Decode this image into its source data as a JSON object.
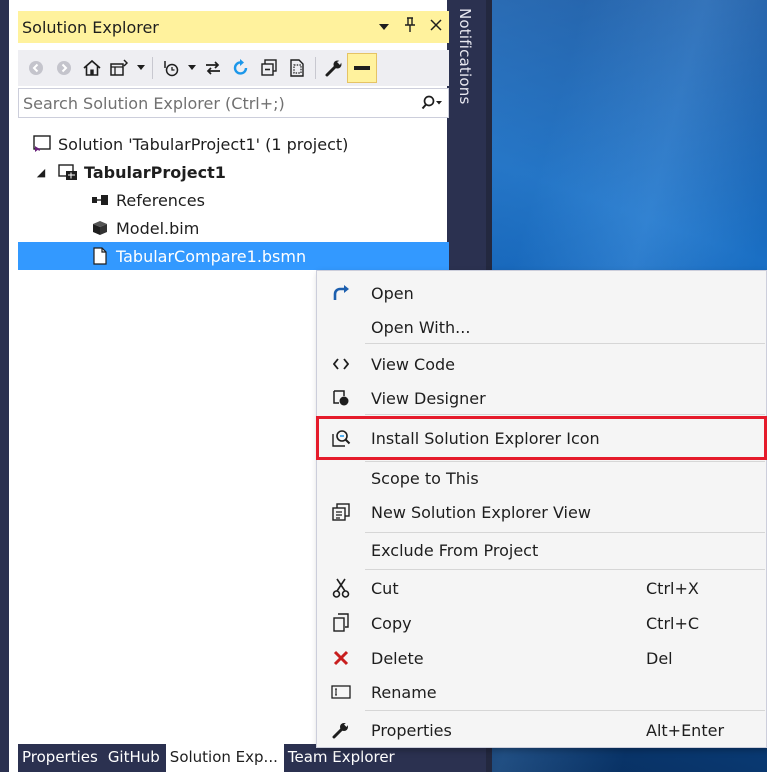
{
  "panel": {
    "title": "Solution Explorer",
    "title_buttons": {
      "dropdown": "▼",
      "pin": "🖈",
      "close": "✕"
    },
    "search_placeholder": "Search Solution Explorer (Ctrl+;)"
  },
  "notifications": {
    "label": "Notifications"
  },
  "tree": {
    "solution": "Solution 'TabularProject1' (1 project)",
    "project": "TabularProject1",
    "items": [
      {
        "label": "References",
        "icon": "references-icon"
      },
      {
        "label": "Model.bim",
        "icon": "model-icon"
      },
      {
        "label": "TabularCompare1.bsmn",
        "icon": "file-icon",
        "selected": true
      }
    ]
  },
  "tabs": [
    {
      "label": "Properties",
      "active": false
    },
    {
      "label": "GitHub",
      "active": false
    },
    {
      "label": "Solution Exp...",
      "active": true
    },
    {
      "label": "Team Explorer",
      "active": false
    }
  ],
  "context_menu": {
    "items": [
      {
        "label": "Open",
        "icon": "open-arrow-icon",
        "shortcut": ""
      },
      {
        "label": "Open With...",
        "icon": "",
        "shortcut": ""
      },
      {
        "label": "View Code",
        "icon": "code-icon",
        "shortcut": ""
      },
      {
        "label": "View Designer",
        "icon": "designer-icon",
        "shortcut": ""
      },
      {
        "label": "Install Solution Explorer Icon",
        "icon": "magnifier-icon",
        "shortcut": "",
        "highlighted": true
      },
      {
        "label": "Scope to This",
        "icon": "",
        "shortcut": ""
      },
      {
        "label": "New Solution Explorer View",
        "icon": "new-view-icon",
        "shortcut": ""
      },
      {
        "label": "Exclude From Project",
        "icon": "",
        "shortcut": ""
      },
      {
        "label": "Cut",
        "icon": "scissors-icon",
        "shortcut": "Ctrl+X"
      },
      {
        "label": "Copy",
        "icon": "copy-icon",
        "shortcut": "Ctrl+C"
      },
      {
        "label": "Delete",
        "icon": "delete-x-icon",
        "shortcut": "Del"
      },
      {
        "label": "Rename",
        "icon": "rename-icon",
        "shortcut": ""
      },
      {
        "label": "Properties",
        "icon": "wrench-icon",
        "shortcut": "Alt+Enter"
      }
    ]
  },
  "colors": {
    "title_active": "#fff29d",
    "selection": "#3399ff",
    "frame": "#2b3150",
    "highlight_box": "#e51b2b",
    "delete_red": "#c81e1e"
  }
}
